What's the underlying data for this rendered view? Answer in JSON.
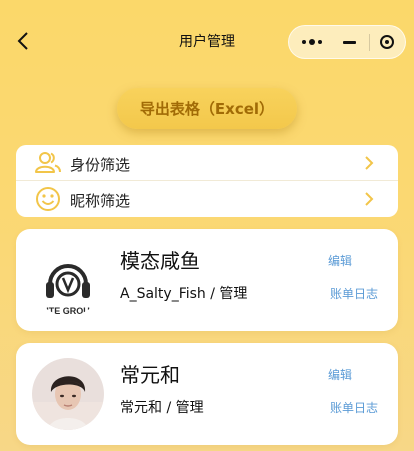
{
  "nav": {
    "title": "用户管理"
  },
  "export": {
    "label": "导出表格（Excel）"
  },
  "filters": [
    {
      "label": "身份筛选",
      "icon": "users-icon"
    },
    {
      "label": "昵称筛选",
      "icon": "smile-icon"
    }
  ],
  "users": [
    {
      "name": "模态咸鱼",
      "sub": "A_Salty_Fish / 管理",
      "edit": "编辑",
      "bill": "账单日志",
      "avatar_text": "ITE GROU"
    },
    {
      "name": "常元和",
      "sub": "常元和 / 管理",
      "edit": "编辑",
      "bill": "账单日志"
    }
  ],
  "colors": {
    "background": "#fbd86a",
    "accent": "#f3c84b",
    "accent_text": "#a16b06",
    "link": "#5b9bd6",
    "icon": "#f2c549"
  }
}
